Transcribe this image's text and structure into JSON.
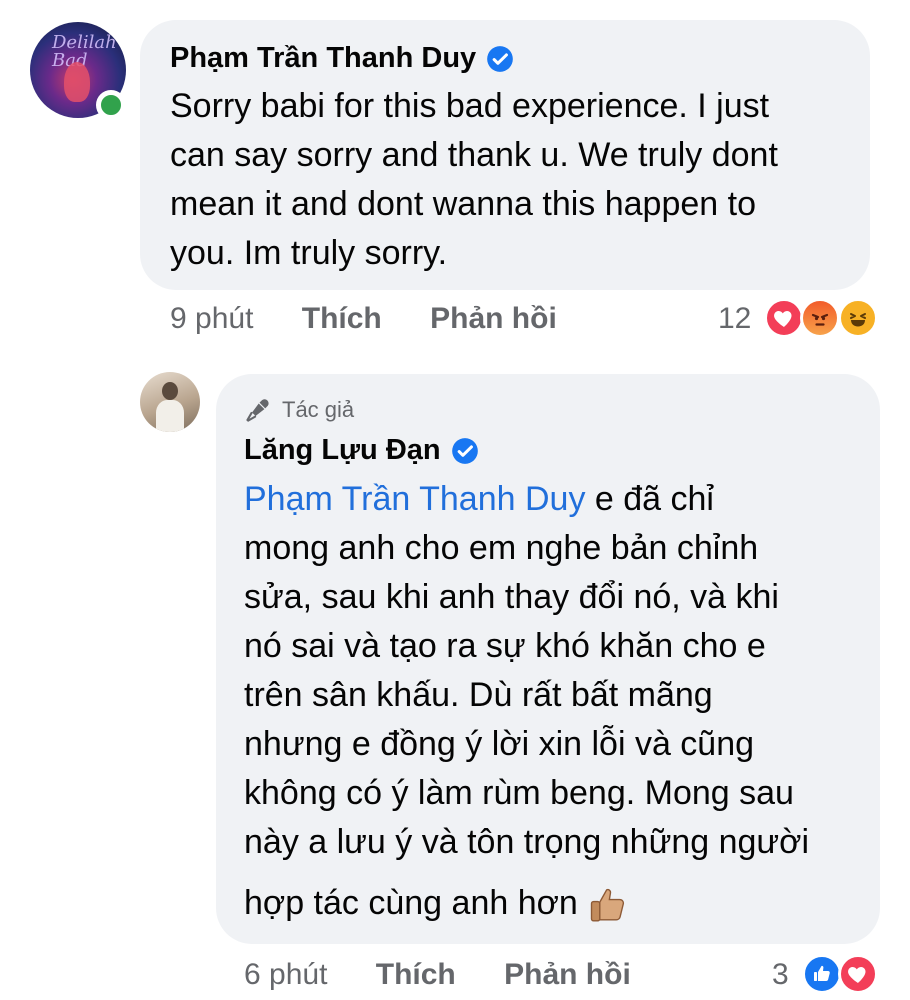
{
  "comment": {
    "author": "Phạm Trần Thanh Duy",
    "avatar_text": "Delilah Bad",
    "lines": [
      "Sorry babi for this bad experience. I just",
      "can say sorry and thank u. We truly dont",
      "mean it and dont wanna this happen to",
      "you. Im truly sorry."
    ],
    "time": "9 phút",
    "like_label": "Thích",
    "reply_label": "Phản hồi",
    "reaction_count": "12",
    "reactions": [
      "heart-icon",
      "angry-icon",
      "haha-icon"
    ]
  },
  "reply": {
    "author_badge": "Tác giả",
    "author": "Lăng Lựu Đạn",
    "mention": "Phạm Trần Thanh Duy",
    "first_line_rest": " e đã chỉ",
    "lines": [
      "mong anh cho em nghe bản chỉnh",
      "sửa, sau khi anh thay đổi nó, và khi",
      "nó sai và tạo ra sự khó khăn cho e",
      "trên sân khấu. Dù rất bất mãng",
      "nhưng e đồng ý lời xin lỗi và cũng",
      "không có ý làm rùm beng. Mong sau",
      "này a lưu ý và tôn trọng những người"
    ],
    "last_line": "hợp tác cùng anh hơn",
    "emoji": "thumbs-up-icon",
    "time": "6 phút",
    "like_label": "Thích",
    "reply_label": "Phản hồi",
    "reaction_count": "3",
    "reactions": [
      "like-icon",
      "heart-icon"
    ]
  },
  "colors": {
    "bubble": "#f0f2f5",
    "mention": "#216fdb",
    "verified": "#1877f2",
    "meta": "#65676b",
    "online": "#31a24c"
  }
}
